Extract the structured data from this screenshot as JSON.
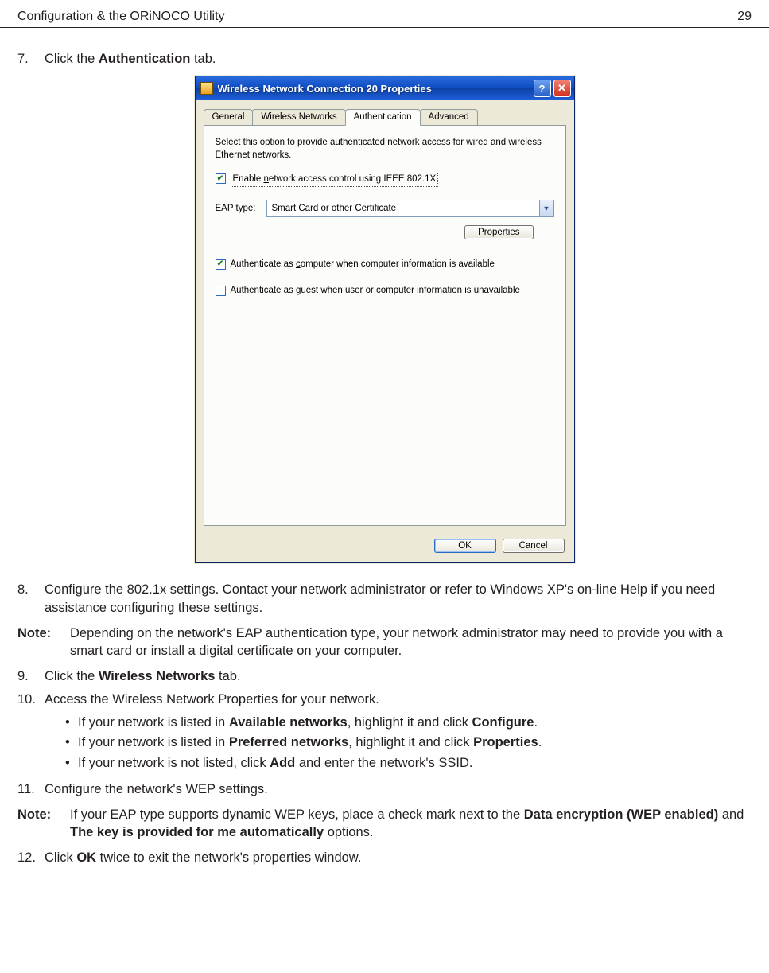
{
  "header": {
    "title": "Configuration & the ORiNOCO Utility",
    "page": "29"
  },
  "step7": {
    "num": "7.",
    "prefix": "Click the ",
    "bold": "Authentication",
    "suffix": " tab."
  },
  "dialog": {
    "title": "Wireless Network Connection 20 Properties",
    "help_btn": "?",
    "close_btn": "✕",
    "tabs": {
      "general": "General",
      "wireless": "Wireless Networks",
      "auth": "Authentication",
      "advanced": "Advanced"
    },
    "helptext": "Select this option to provide authenticated network access for wired and wireless Ethernet networks.",
    "cb_enable_pre": "Enable ",
    "cb_enable_u": "n",
    "cb_enable_post": "etwork access control using IEEE 802.1X",
    "eap_label_pre": "",
    "eap_label_u": "E",
    "eap_label_post": "AP type:",
    "eap_value": "Smart Card or other Certificate",
    "properties_btn": "Properties",
    "cb_computer_pre": "Authenticate as ",
    "cb_computer_u": "c",
    "cb_computer_post": "omputer when computer information is available",
    "cb_guest_pre": "Authenticate as ",
    "cb_guest_u": "g",
    "cb_guest_post": "uest when user or computer information is unavailable",
    "ok": "OK",
    "cancel": "Cancel"
  },
  "step8": {
    "num": "8.",
    "text": "Configure the 802.1x settings. Contact your network administrator or refer to Windows XP's on-line Help if you need assistance configuring these settings."
  },
  "note1": {
    "label": "Note:",
    "text": "Depending on the network's EAP authentication type, your network administrator may need to provide you with a smart card or install a digital certificate on your computer."
  },
  "step9": {
    "num": "9.",
    "prefix": "Click the ",
    "bold": "Wireless Networks",
    "suffix": " tab."
  },
  "step10": {
    "num": "10.",
    "text": "Access the Wireless Network Properties for your network.",
    "b1a": "If your network is listed in ",
    "b1b": "Available networks",
    "b1c": ", highlight it and click ",
    "b1d": "Configure",
    "b1e": ".",
    "b2a": "If your network is listed in ",
    "b2b": "Preferred networks",
    "b2c": ", highlight it and click ",
    "b2d": "Properties",
    "b2e": ".",
    "b3a": "If your network is not listed, click ",
    "b3b": "Add",
    "b3c": " and enter the network's SSID."
  },
  "step11": {
    "num": "11.",
    "text": "Configure the network's WEP settings."
  },
  "note2": {
    "label": "Note:",
    "pre": "If your EAP type supports dynamic WEP keys, place a check mark next to the ",
    "b1": "Data encryption (WEP enabled)",
    "mid": " and ",
    "b2": "The key is provided for me automatically",
    "post": " options."
  },
  "step12": {
    "num": "12.",
    "prefix": "Click ",
    "bold": "OK",
    "suffix": " twice to exit the network's properties window."
  }
}
